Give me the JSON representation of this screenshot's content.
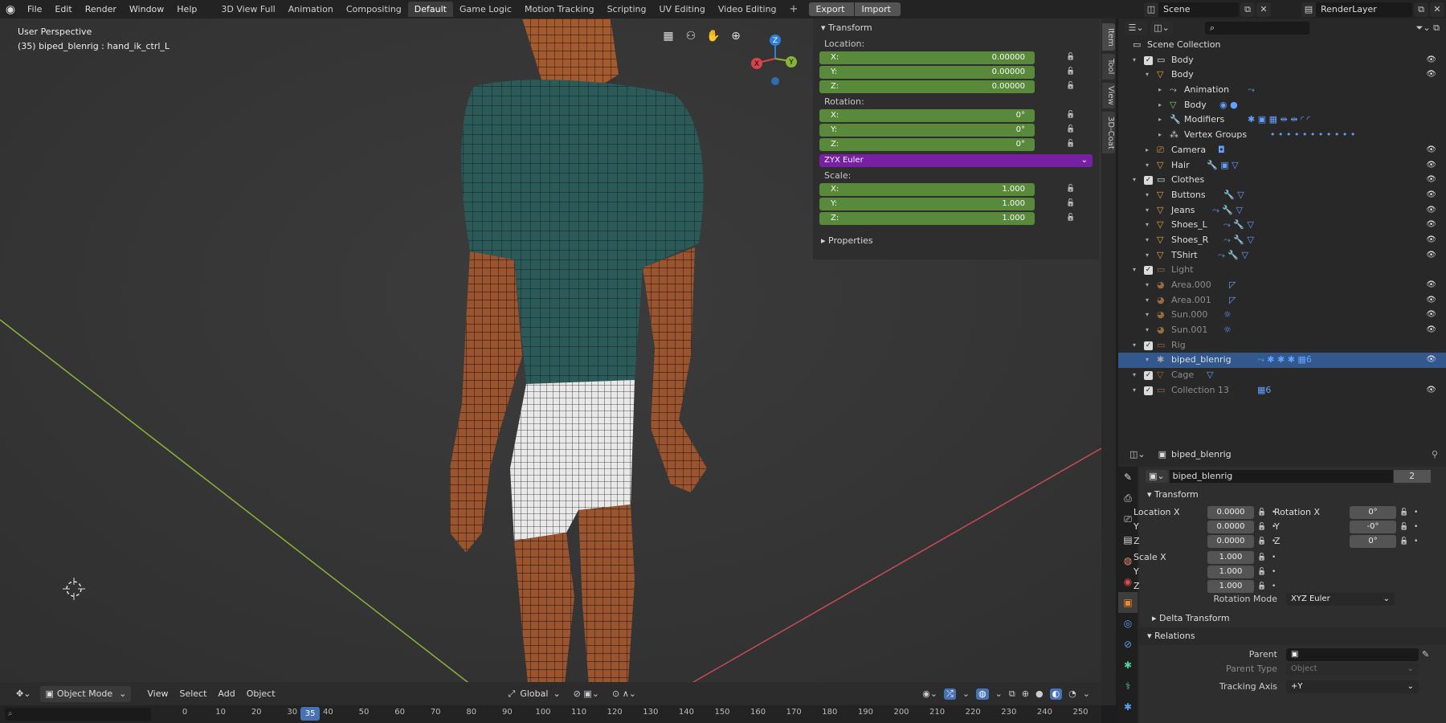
{
  "menu": [
    "File",
    "Edit",
    "Render",
    "Window",
    "Help"
  ],
  "workspaces": [
    "3D View Full",
    "Animation",
    "Compositing",
    "Default",
    "Game Logic",
    "Motion Tracking",
    "Scripting",
    "UV Editing",
    "Video Editing"
  ],
  "active_workspace": "Default",
  "addon_buttons": {
    "export": "Export",
    "import": "Import"
  },
  "scene_name": "Scene",
  "view_layer": "RenderLayer",
  "viewport": {
    "perspective": "User Perspective",
    "active_object": "(35) biped_blenrig : hand_ik_ctrl_L"
  },
  "npanel": {
    "title": "Transform",
    "location_label": "Location:",
    "location": [
      {
        "axis": "X:",
        "value": "0.00000"
      },
      {
        "axis": "Y:",
        "value": "0.00000"
      },
      {
        "axis": "Z:",
        "value": "0.00000"
      }
    ],
    "rotation_label": "Rotation:",
    "rotation": [
      {
        "axis": "X:",
        "value": "0°"
      },
      {
        "axis": "Y:",
        "value": "0°"
      },
      {
        "axis": "Z:",
        "value": "0°"
      }
    ],
    "rotation_mode": "ZYX Euler",
    "scale_label": "Scale:",
    "scale": [
      {
        "axis": "X:",
        "value": "1.000"
      },
      {
        "axis": "Y:",
        "value": "1.000"
      },
      {
        "axis": "Z:",
        "value": "1.000"
      }
    ],
    "properties_label": "Properties"
  },
  "side_tabs": [
    "Item",
    "Tool",
    "View",
    "3D-Coat"
  ],
  "outliner": {
    "root": "Scene Collection",
    "items": [
      {
        "label": "Body",
        "kind": "collection",
        "depth": 0,
        "checkbox": true,
        "eye": true,
        "mods": ""
      },
      {
        "label": "Body",
        "kind": "mesh",
        "depth": 1,
        "eye": true,
        "mods": ""
      },
      {
        "label": "Animation",
        "kind": "anim",
        "depth": 2,
        "mods": "⤳"
      },
      {
        "label": "Body",
        "kind": "data",
        "depth": 2,
        "mods": "◉ ●"
      },
      {
        "label": "Modifiers",
        "kind": "wrench",
        "depth": 2,
        "mods": "✱ ▣ ▦ ⇹ ⇹ ◜ ◜"
      },
      {
        "label": "Vertex Groups",
        "kind": "vgroup",
        "depth": 2,
        "mods": "• • • • • • • • • • •"
      },
      {
        "label": "Camera",
        "kind": "camera",
        "depth": 1,
        "eye": true,
        "mods": "◘"
      },
      {
        "label": "Hair",
        "kind": "mesh",
        "depth": 1,
        "eye": true,
        "mods": "🔧 ▣ ▽"
      },
      {
        "label": "Clothes",
        "kind": "collection",
        "depth": 0,
        "checkbox": true,
        "eye": true,
        "mods": ""
      },
      {
        "label": "Buttons",
        "kind": "mesh",
        "depth": 1,
        "eye": true,
        "mods": "🔧 ▽"
      },
      {
        "label": "Jeans",
        "kind": "mesh",
        "depth": 1,
        "eye": true,
        "mods": "⤳ 🔧 ▽"
      },
      {
        "label": "Shoes_L",
        "kind": "mesh",
        "depth": 1,
        "eye": true,
        "mods": "⤳ 🔧 ▽"
      },
      {
        "label": "Shoes_R",
        "kind": "mesh",
        "depth": 1,
        "eye": true,
        "mods": "⤳ 🔧 ▽"
      },
      {
        "label": "TShirt",
        "kind": "mesh",
        "depth": 1,
        "eye": true,
        "mods": "⤳ 🔧 ▽"
      },
      {
        "label": "Light",
        "kind": "collection",
        "depth": 0,
        "checkbox": true,
        "dim": true,
        "mods": ""
      },
      {
        "label": "Area.000",
        "kind": "light",
        "depth": 1,
        "dim": true,
        "eye": true,
        "mods": "◸"
      },
      {
        "label": "Area.001",
        "kind": "light",
        "depth": 1,
        "dim": true,
        "eye": true,
        "mods": "◸"
      },
      {
        "label": "Sun.000",
        "kind": "light",
        "depth": 1,
        "dim": true,
        "eye": true,
        "mods": "☼"
      },
      {
        "label": "Sun.001",
        "kind": "light",
        "depth": 1,
        "dim": true,
        "eye": true,
        "mods": "☼"
      },
      {
        "label": "Rig",
        "kind": "collection",
        "depth": 0,
        "checkbox": true,
        "dim": true,
        "mods": ""
      },
      {
        "label": "biped_blenrig",
        "kind": "armature",
        "depth": 1,
        "selected": true,
        "eye": true,
        "mods": "⤳ ✱ ✱ ✱ ▦6"
      },
      {
        "label": "Cage",
        "kind": "mesh",
        "depth": 0,
        "checkbox": true,
        "dim": true,
        "mods": "▽"
      },
      {
        "label": "Collection 13",
        "kind": "collection",
        "depth": 0,
        "checkbox": true,
        "dim": true,
        "eye": true,
        "mods": "▦6"
      }
    ]
  },
  "properties": {
    "header_object": "biped_blenrig",
    "object_name": "biped_blenrig",
    "users": "2",
    "transform_label": "Transform",
    "location_x_label": "Location X",
    "rotation_x_label": "Rotation X",
    "scale_x_label": "Scale X",
    "y_label": "Y",
    "z_label": "Z",
    "location": [
      "0.0000",
      "0.0000",
      "0.0000"
    ],
    "rotation": [
      "0°",
      "-0°",
      "0°"
    ],
    "scale": [
      "1.000",
      "1.000",
      "1.000"
    ],
    "rotation_mode_label": "Rotation Mode",
    "rotation_mode": "XYZ Euler",
    "delta_label": "Delta Transform",
    "relations_label": "Relations",
    "parent_label": "Parent",
    "parent_type_label": "Parent Type",
    "parent_type": "Object",
    "tracking_label": "Tracking Axis",
    "tracking": "+Y"
  },
  "header3d": {
    "mode": "Object Mode",
    "menus": [
      "View",
      "Select",
      "Add",
      "Object"
    ],
    "orientation": "Global"
  },
  "timeline": {
    "current_frame": "35",
    "ticks": [
      "0",
      "10",
      "20",
      "30",
      "40",
      "50",
      "60",
      "70",
      "80",
      "90",
      "100",
      "110",
      "120",
      "130",
      "140",
      "150",
      "160",
      "170",
      "180",
      "190",
      "200",
      "210",
      "220",
      "230",
      "240",
      "250"
    ]
  },
  "colors": {
    "selected": "#33588e",
    "field_green": "#5b8c3c",
    "euler_purple": "#7b20a6",
    "frame_blue": "#4772b3"
  }
}
